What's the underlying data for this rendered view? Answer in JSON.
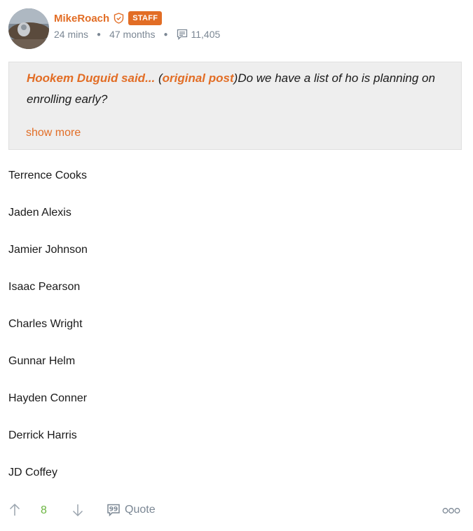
{
  "post": {
    "author": {
      "username": "MikeRoach",
      "badge": "STAFF",
      "time_ago": "24 mins",
      "member_for": "47 months",
      "post_count": "11,405"
    },
    "quote": {
      "author": "Hookem Duguid said...",
      "open_paren": " (",
      "link_label": "original post",
      "close_paren": ")",
      "text": "Do we have a list of ho is planning on enrolling early?",
      "show_more": "show more"
    },
    "names": [
      "Terrence Cooks",
      "Jaden Alexis",
      "Jamier Johnson",
      "Isaac Pearson",
      "Charles Wright",
      "Gunnar Helm",
      "Hayden Conner",
      "Derrick Harris",
      "JD Coffey"
    ],
    "actions": {
      "vote_count": "8",
      "quote_label": "Quote"
    }
  },
  "colors": {
    "accent": "#e26d25",
    "muted": "#7b8794",
    "vote_green": "#6bb541",
    "quote_bg": "#eeeeee"
  },
  "icons": [
    "verified-shield-icon",
    "posts-icon",
    "upvote-arrow-icon",
    "downvote-arrow-icon",
    "quote-icon",
    "more-options-icon"
  ]
}
